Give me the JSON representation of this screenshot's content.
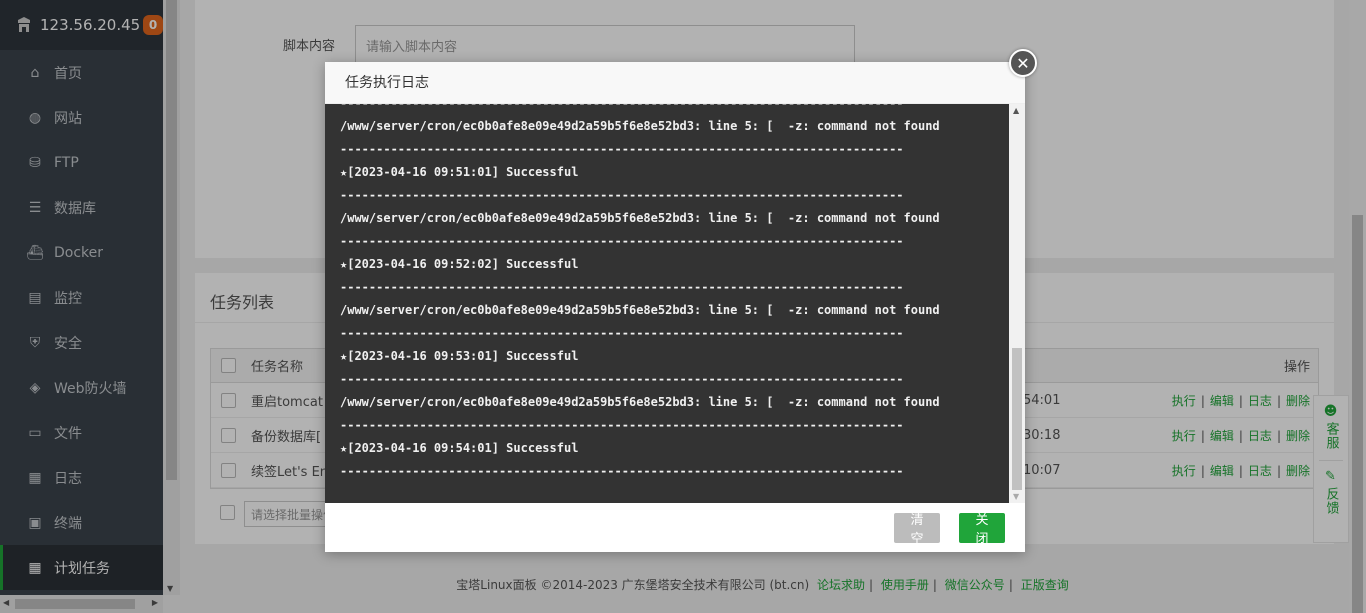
{
  "sidebar": {
    "ip": "123.56.20.45",
    "badge": "0",
    "items": [
      {
        "label": "首页",
        "icon": "home-icon"
      },
      {
        "label": "网站",
        "icon": "globe-icon"
      },
      {
        "label": "FTP",
        "icon": "ftp-icon"
      },
      {
        "label": "数据库",
        "icon": "database-icon"
      },
      {
        "label": "Docker",
        "icon": "docker-icon"
      },
      {
        "label": "监控",
        "icon": "monitor-icon"
      },
      {
        "label": "安全",
        "icon": "shield-icon"
      },
      {
        "label": "Web防火墙",
        "icon": "firewall-icon"
      },
      {
        "label": "文件",
        "icon": "folder-icon"
      },
      {
        "label": "日志",
        "icon": "log-icon"
      },
      {
        "label": "终端",
        "icon": "terminal-icon"
      },
      {
        "label": "计划任务",
        "icon": "calendar-icon"
      }
    ],
    "active_index": 11
  },
  "form": {
    "script_label": "脚本内容",
    "script_placeholder": "请输入脚本内容"
  },
  "task_list": {
    "title": "任务列表",
    "col_name": "任务名称",
    "col_op": "操作",
    "rows": [
      {
        "name": "重启tomcat",
        "time": "54:01"
      },
      {
        "name": "备份数据库[ 所",
        "time": "30:18"
      },
      {
        "name": "续签Let's Encr",
        "time": "10:07"
      }
    ],
    "ops": [
      "执行",
      "编辑",
      "日志",
      "删除"
    ],
    "batch_placeholder": "请选择批量操作"
  },
  "footer": {
    "copyright": "宝塔Linux面板 ©2014-2023 广东堡塔安全技术有限公司 (bt.cn)",
    "links": [
      "论坛求助",
      "使用手册",
      "微信公众号",
      "正版查询"
    ]
  },
  "side_help": {
    "service": "客服",
    "feedback": "反馈"
  },
  "modal": {
    "title": "任务执行日志",
    "log_lines": [
      "------------------------------------------------------------------------------",
      "/www/server/cron/ec0b0afe8e09e49d2a59b5f6e8e52bd3: line 5: [  -z: command not found",
      "------------------------------------------------------------------------------",
      "★[2023-04-16 09:51:01] Successful",
      "------------------------------------------------------------------------------",
      "/www/server/cron/ec0b0afe8e09e49d2a59b5f6e8e52bd3: line 5: [  -z: command not found",
      "------------------------------------------------------------------------------",
      "★[2023-04-16 09:52:02] Successful",
      "------------------------------------------------------------------------------",
      "/www/server/cron/ec0b0afe8e09e49d2a59b5f6e8e52bd3: line 5: [  -z: command not found",
      "------------------------------------------------------------------------------",
      "★[2023-04-16 09:53:01] Successful",
      "------------------------------------------------------------------------------",
      "/www/server/cron/ec0b0afe8e09e49d2a59b5f6e8e52bd3: line 5: [  -z: command not found",
      "------------------------------------------------------------------------------",
      "★[2023-04-16 09:54:01] Successful",
      "------------------------------------------------------------------------------"
    ],
    "clear_label": "清空",
    "close_label": "关闭"
  },
  "colors": {
    "accent": "#20a53a",
    "sidebar_bg": "#3c444d",
    "badge": "#e2661d",
    "log_bg": "#333333"
  }
}
